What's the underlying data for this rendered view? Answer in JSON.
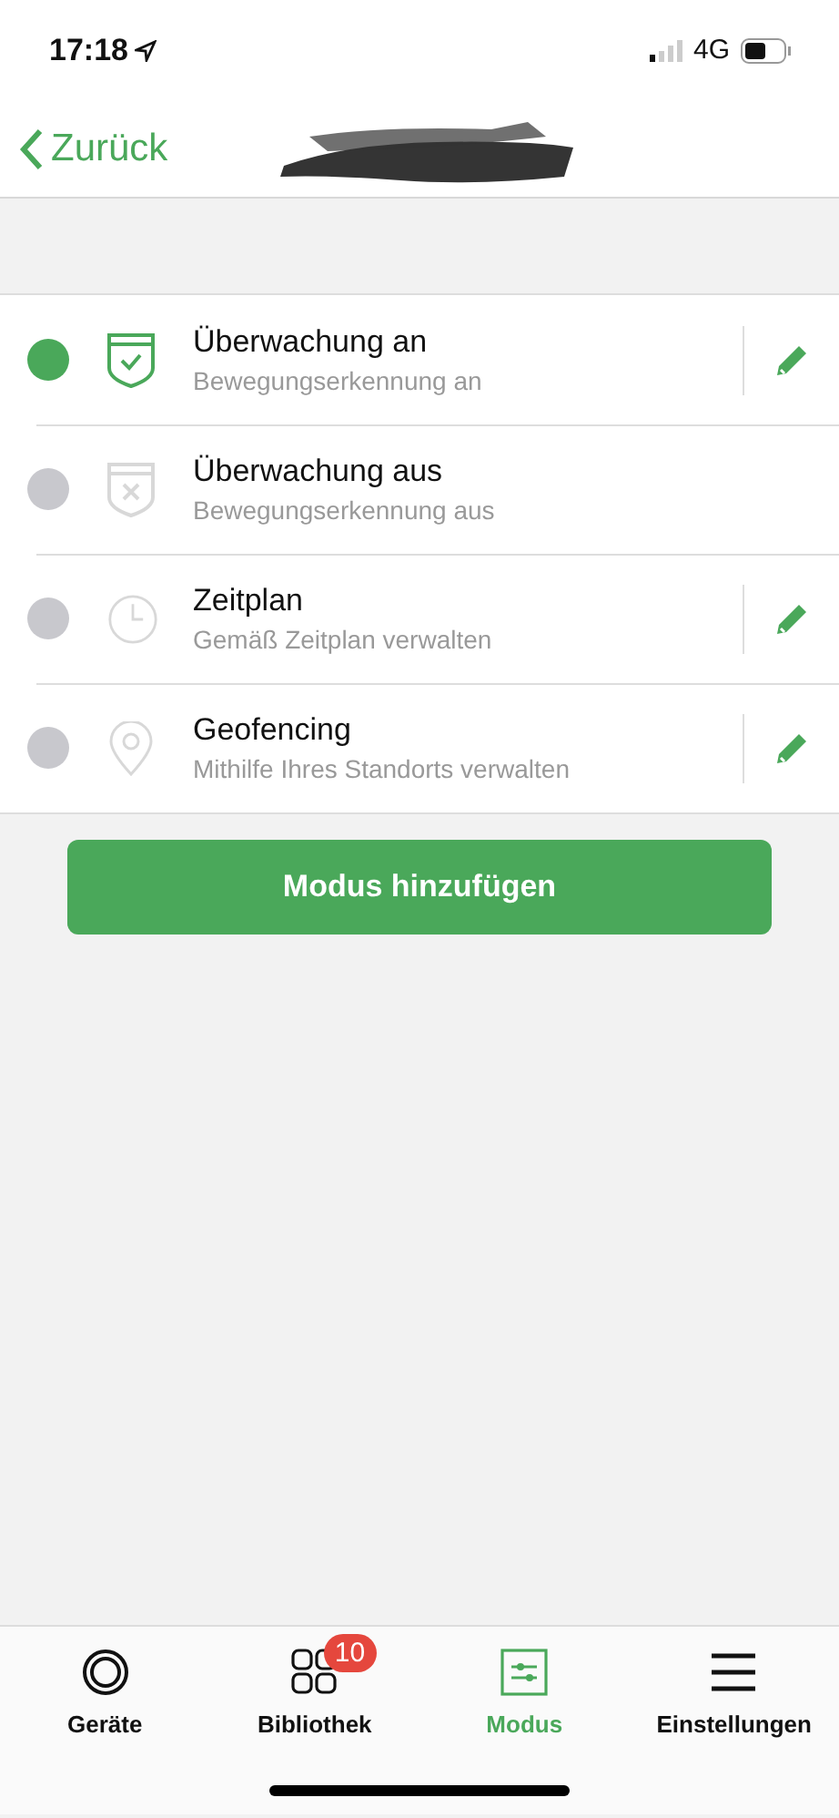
{
  "status_bar": {
    "time": "17:18",
    "network": "4G"
  },
  "nav": {
    "back": "Zurück"
  },
  "modes": [
    {
      "kind": "shield-check",
      "title": "Überwachung an",
      "subtitle": "Bewegungserkennung an",
      "selected": true,
      "editable": true
    },
    {
      "kind": "shield-x",
      "title": "Überwachung aus",
      "subtitle": "Bewegungserkennung aus",
      "selected": false,
      "editable": false
    },
    {
      "kind": "clock",
      "title": "Zeitplan",
      "subtitle": "Gemäß Zeitplan verwalten",
      "selected": false,
      "editable": true
    },
    {
      "kind": "pin",
      "title": "Geofencing",
      "subtitle": "Mithilfe Ihres Standorts verwalten",
      "selected": false,
      "editable": true
    }
  ],
  "add_button": "Modus hinzufügen",
  "tabs": [
    {
      "kind": "camera",
      "label": "Geräte",
      "selected": false
    },
    {
      "kind": "grid",
      "label": "Bibliothek",
      "selected": false,
      "badge": "10"
    },
    {
      "kind": "sliders",
      "label": "Modus",
      "selected": true
    },
    {
      "kind": "menu",
      "label": "Einstellungen",
      "selected": false
    }
  ]
}
